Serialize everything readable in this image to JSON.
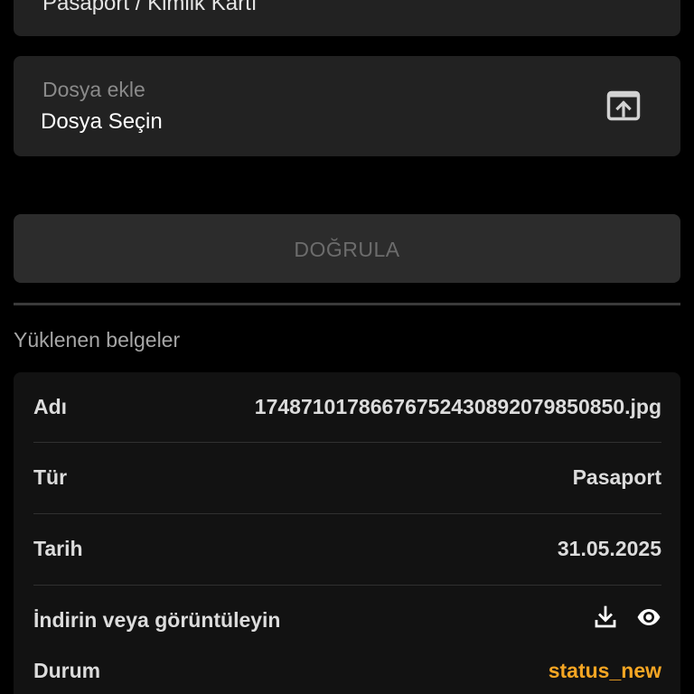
{
  "document_type_select": {
    "value": "Pasaport / Kimlik Kartı"
  },
  "file_input": {
    "label": "Dosya ekle",
    "value": "Dosya Seçin",
    "icon": "upload-file-icon"
  },
  "verify_button": {
    "label": "DOĞRULA"
  },
  "uploaded_documents": {
    "title": "Yüklenen belgeler",
    "rows": [
      {
        "label": "Adı",
        "value": "1748710178667675243089207985085​0.jpg"
      },
      {
        "label": "Tür",
        "value": "Pasaport"
      },
      {
        "label": "Tarih",
        "value": "31.05.2025"
      }
    ],
    "actions": {
      "label": "İndirin veya görüntüleyin",
      "icons": [
        "download-icon",
        "eye-icon"
      ]
    },
    "status": {
      "label": "Durum",
      "value": "status_new",
      "color": "#f5a623"
    }
  },
  "colors": {
    "background": "#000000",
    "field_background": "#222222",
    "card_background": "#121212",
    "accent": "#f5a623"
  }
}
